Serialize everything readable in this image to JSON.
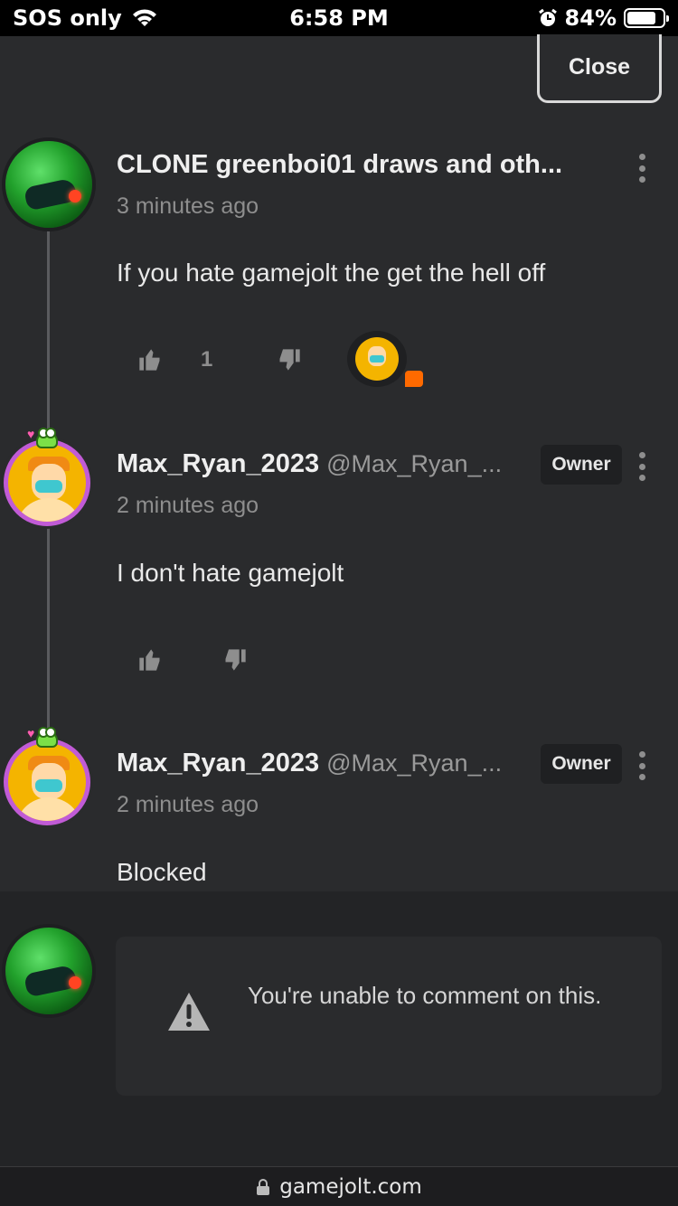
{
  "status_bar": {
    "carrier": "SOS only",
    "time": "6:58 PM",
    "battery_percent": "84%",
    "battery_level": 0.84,
    "icons": [
      "wifi-icon",
      "alarm-icon",
      "battery-icon"
    ]
  },
  "close_label": "Close",
  "comments": [
    {
      "username": "CLONE greenboi01 draws and oth...",
      "handle": "",
      "time": "3 minutes ago",
      "text": "If you hate gamejolt the get the hell off",
      "likes": "1",
      "badge": ""
    },
    {
      "username": "Max_Ryan_2023",
      "handle": "@Max_Ryan_...",
      "time": "2 minutes ago",
      "text": "I don't hate gamejolt",
      "badge": "Owner"
    },
    {
      "username": "Max_Ryan_2023",
      "handle": "@Max_Ryan_...",
      "time": "2 minutes ago",
      "text": "Blocked",
      "badge": "Owner"
    }
  ],
  "notice": {
    "text": "You're unable to comment on this.",
    "icon": "warning-icon"
  },
  "url_bar": {
    "domain": "gamejolt.com",
    "icon": "lock-icon"
  },
  "colors": {
    "background": "#2a2b2d",
    "owner_ring": "#c15bd6",
    "reply_badge": "#ff6a00"
  }
}
